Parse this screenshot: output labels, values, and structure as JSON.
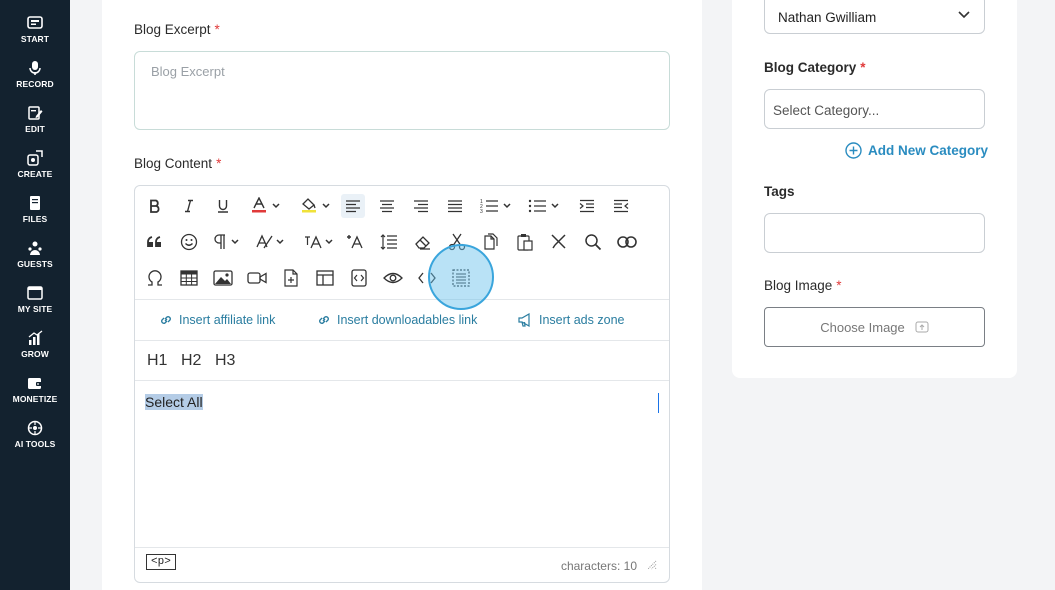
{
  "sidebar": {
    "items": [
      {
        "label": "START",
        "icon": "start-icon"
      },
      {
        "label": "RECORD",
        "icon": "microphone-icon"
      },
      {
        "label": "EDIT",
        "icon": "edit-icon"
      },
      {
        "label": "CREATE",
        "icon": "create-icon"
      },
      {
        "label": "FILES",
        "icon": "files-icon"
      },
      {
        "label": "GUESTS",
        "icon": "guests-icon"
      },
      {
        "label": "MY SITE",
        "icon": "site-icon"
      },
      {
        "label": "GROW",
        "icon": "chart-icon"
      },
      {
        "label": "MONETIZE",
        "icon": "monetize-icon"
      },
      {
        "label": "AI TOOLS",
        "icon": "ai-icon"
      }
    ]
  },
  "form": {
    "excerpt": {
      "label": "Blog Excerpt",
      "required_mark": "*",
      "placeholder": "Blog Excerpt",
      "value": ""
    },
    "content": {
      "label": "Blog Content",
      "required_mark": "*"
    }
  },
  "editor": {
    "toolbar_rows": [
      [
        "bold",
        "italic",
        "underline",
        "font-color",
        "highlight-color",
        "align-left",
        "align-center",
        "align-right",
        "align-justify",
        "ordered-list",
        "unordered-list",
        "indent",
        "outdent"
      ],
      [
        "quote",
        "emoji",
        "paragraph-format",
        "font-size",
        "font-family",
        "text-transform",
        "line-height",
        "clear-format",
        "cut",
        "copy",
        "paste",
        "strikethrough-tool",
        "find",
        "link"
      ],
      [
        "special-chars",
        "table",
        "image",
        "video",
        "file",
        "layout",
        "code-block",
        "preview",
        "source-code",
        "select-all"
      ]
    ],
    "quick_links": {
      "affiliate": "Insert affiliate link",
      "downloadables": "Insert downloadables link",
      "ads": "Insert ads zone"
    },
    "headings": [
      "H1",
      "H2",
      "H3"
    ],
    "content_text": "Select All",
    "status_tag": "<p>",
    "char_count": "characters: 10"
  },
  "right_panel": {
    "author": {
      "value": "Nathan Gwilliam"
    },
    "category": {
      "label": "Blog Category",
      "required_mark": "*",
      "placeholder": "Select Category..."
    },
    "add_category": "Add New Category",
    "tags": {
      "label": "Tags",
      "value": ""
    },
    "image": {
      "label": "Blog Image",
      "required_mark": "*",
      "button": "Choose Image"
    }
  },
  "colors": {
    "sidebar_bg": "#13222f",
    "accent": "#2a8cc0",
    "required": "#e03a3a",
    "font_color_swatch": "#e03a3a",
    "highlight_swatch": "#f0e23a",
    "selection": "#b4cce6"
  }
}
